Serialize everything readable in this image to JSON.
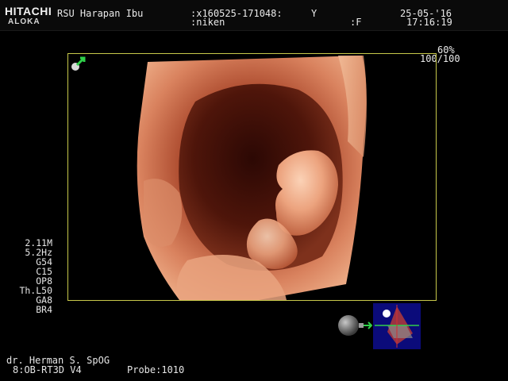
{
  "header": {
    "brand_line1": "HITACHI",
    "brand_line2": "ALOKA",
    "hospital": "RSU Harapan Ibu",
    "patient_id": ":x160525-171048:",
    "id_flag": "Y",
    "patient_name": ":niken",
    "sex": ":F",
    "date": "25-05-'16",
    "time": "17:16:19"
  },
  "image": {
    "gain_percent": "60%",
    "frame_ratio": "100/100"
  },
  "parameters": [
    "2.11M",
    "5.2Hz",
    "G54",
    "C15",
    "OP8",
    "Th.L50",
    "GA8",
    "BR4"
  ],
  "footer": {
    "operator": "dr. Herman S. SpOG",
    "preset": "8:OB-RT3D V4",
    "probe": "Probe:1010"
  },
  "colors": {
    "frame_border": "#c7c84a",
    "tissue": "#d9825e",
    "orientation_bg": "#0b0b7a"
  },
  "icons": {
    "corner": "green-arrow-icon",
    "light": "light-source-icon",
    "orientation": "3d-orientation-icon"
  }
}
